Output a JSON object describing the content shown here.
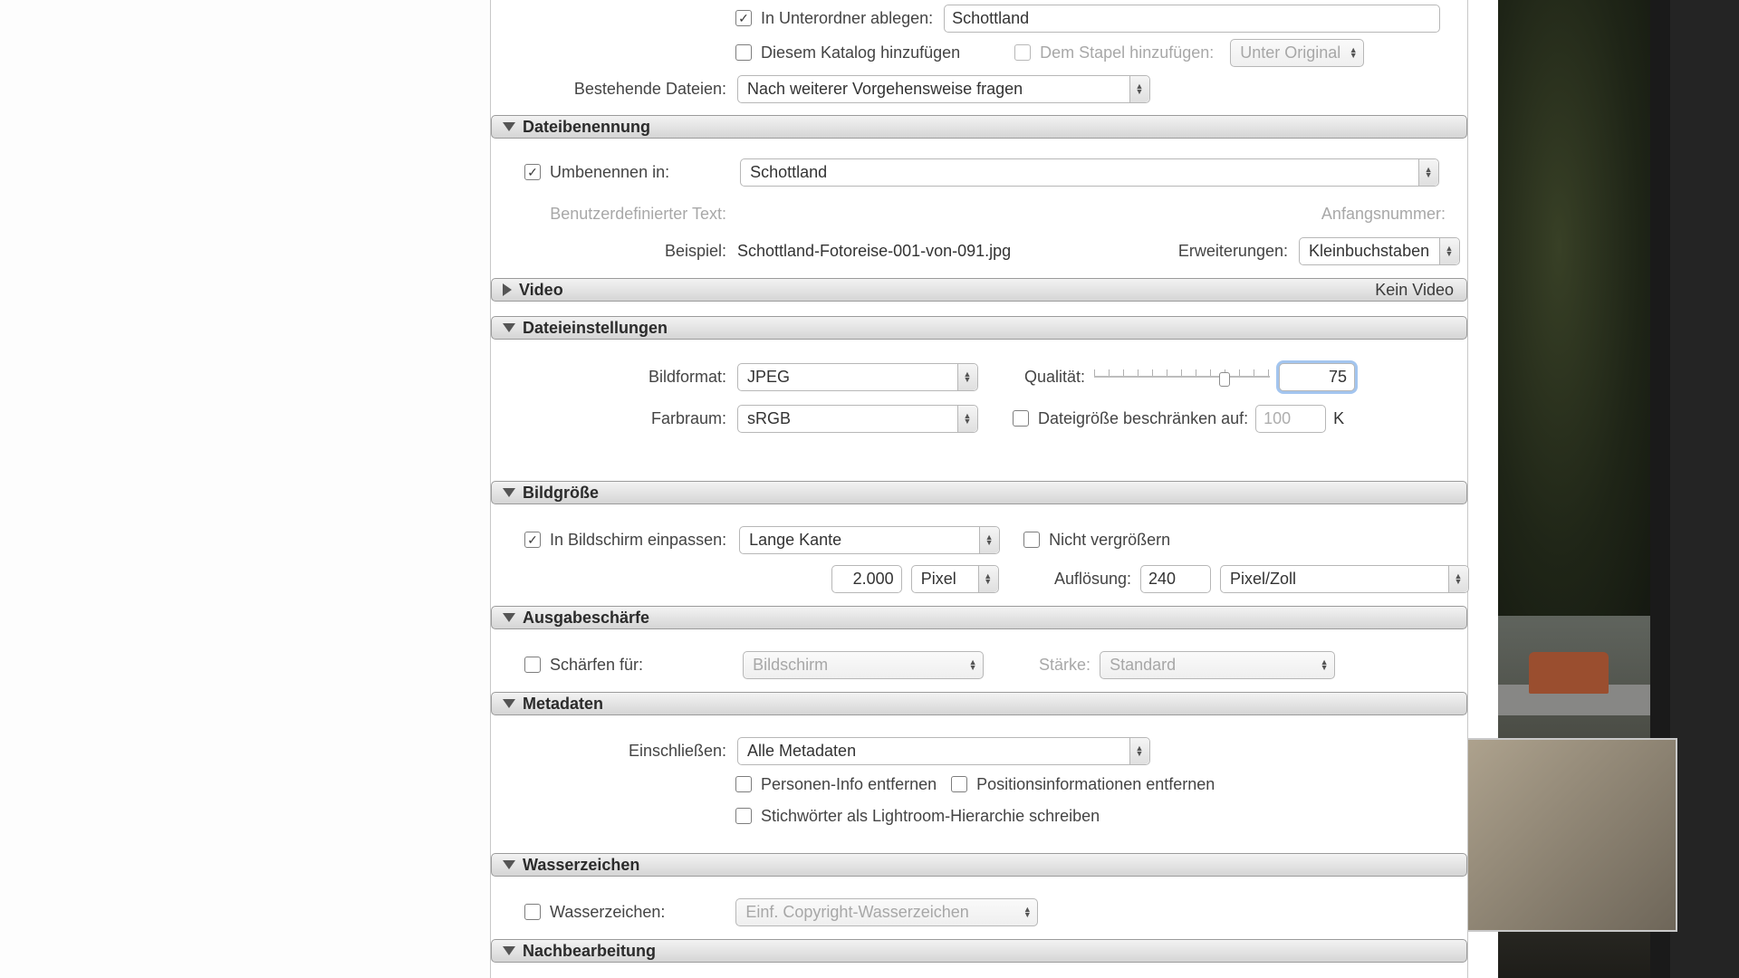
{
  "top": {
    "subfolder_label": "In Unterordner ablegen:",
    "subfolder_value": "Schottland",
    "add_catalog": "Diesem Katalog hinzufügen",
    "add_stack": "Dem Stapel hinzufügen:",
    "stack_pos": "Unter Original",
    "existing_label": "Bestehende Dateien:",
    "existing_value": "Nach weiterer Vorgehensweise fragen"
  },
  "naming": {
    "title": "Dateibenennung",
    "rename_label": "Umbenennen in:",
    "rename_value": "Schottland",
    "custom_text_label": "Benutzerdefinierter Text:",
    "startnum_label": "Anfangsnummer:",
    "example_label": "Beispiel:",
    "example_value": "Schottland-Fotoreise-001-von-091.jpg",
    "ext_label": "Erweiterungen:",
    "ext_value": "Kleinbuchstaben"
  },
  "video": {
    "title": "Video",
    "status": "Kein Video"
  },
  "filesettings": {
    "title": "Dateieinstellungen",
    "format_label": "Bildformat:",
    "format_value": "JPEG",
    "quality_label": "Qualität:",
    "quality_value": "75",
    "colorspace_label": "Farbraum:",
    "colorspace_value": "sRGB",
    "limit_label": "Dateigröße beschränken auf:",
    "limit_value": "100",
    "limit_unit": "K"
  },
  "size": {
    "title": "Bildgröße",
    "fit_label": "In Bildschirm einpassen:",
    "fit_value": "Lange Kante",
    "noenlarge": "Nicht vergrößern",
    "dim_value": "2.000",
    "dim_unit": "Pixel",
    "res_label": "Auflösung:",
    "res_value": "240",
    "res_unit": "Pixel/Zoll"
  },
  "sharpen": {
    "title": "Ausgabeschärfe",
    "for_label": "Schärfen für:",
    "for_value": "Bildschirm",
    "amount_label": "Stärke:",
    "amount_value": "Standard"
  },
  "meta": {
    "title": "Metadaten",
    "include_label": "Einschließen:",
    "include_value": "Alle Metadaten",
    "remove_people": "Personen-Info entfernen",
    "remove_location": "Positionsinformationen entfernen",
    "keywords_hierarchy": "Stichwörter als Lightroom-Hierarchie schreiben"
  },
  "watermark": {
    "title": "Wasserzeichen",
    "label": "Wasserzeichen:",
    "value": "Einf. Copyright-Wasserzeichen"
  },
  "post": {
    "title": "Nachbearbeitung"
  },
  "slider": {
    "quality_pos_pct": 74
  }
}
